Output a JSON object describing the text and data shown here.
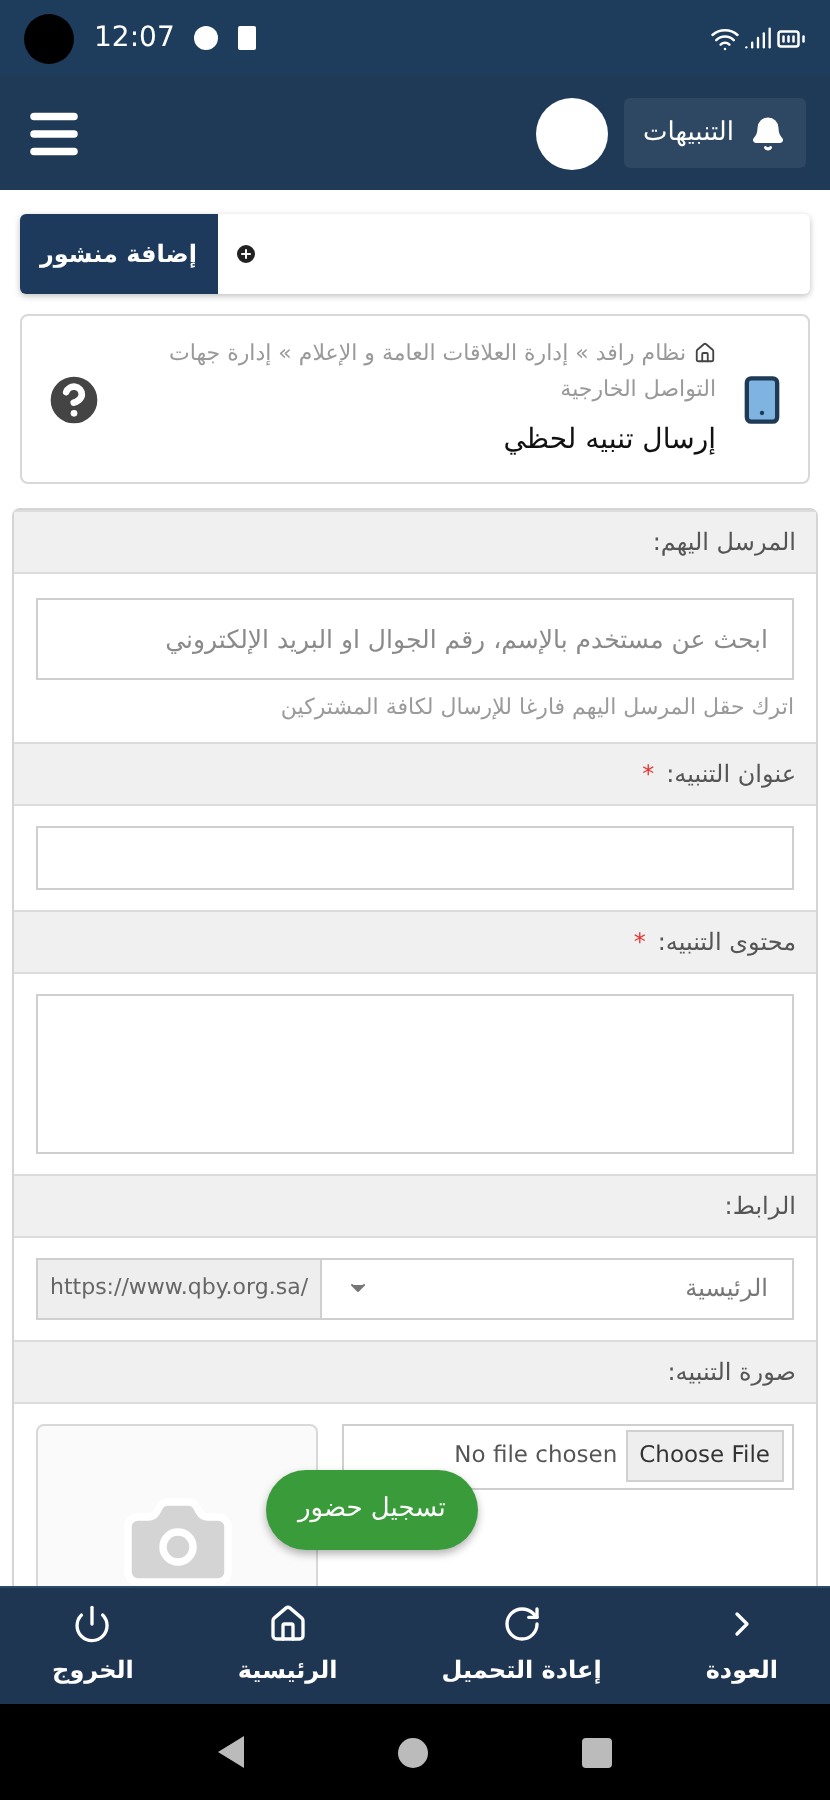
{
  "status_bar": {
    "time": "12:07"
  },
  "header": {
    "notifications_button": "التنبيهات"
  },
  "add_post_button": "إضافة منشور",
  "page_header": {
    "breadcrumb": "نظام رافد » إدارة العلاقات العامة و الإعلام » إدارة جهات التواصل الخارجية",
    "title": "إرسال تنبيه لحظي"
  },
  "form": {
    "sections": [
      {
        "kind": "search",
        "label": "المرسل اليهم:",
        "placeholder": "ابحث عن مستخدم بالإسم، رقم الجوال او البريد الإلكتروني",
        "hint": "اترك حقل المرسل اليهم فارغا للإرسال لكافة المشتركين"
      },
      {
        "kind": "text",
        "label": "عنوان التنبيه:",
        "required_mark": "*"
      },
      {
        "kind": "textarea",
        "label": "محتوى التنبيه:",
        "required_mark": "*"
      },
      {
        "kind": "link",
        "label": "الرابط:",
        "prefix": "https://www.qby.org.sa/",
        "value": "الرئيسية"
      },
      {
        "kind": "file",
        "label": "صورة التنبيه:",
        "button": "Choose File",
        "status": "No file chosen"
      }
    ]
  },
  "floating_button": "تسجيل حضور",
  "bottom_nav": [
    {
      "label": "العودة"
    },
    {
      "label": "إعادة التحميل"
    },
    {
      "label": "الرئيسية"
    },
    {
      "label": "الخروج"
    }
  ]
}
